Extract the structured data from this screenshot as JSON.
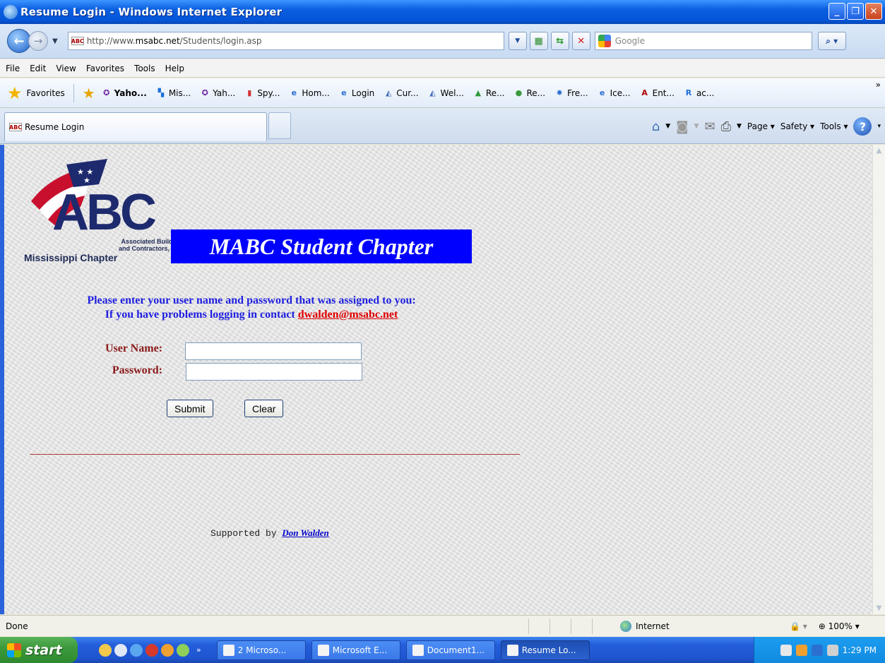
{
  "window": {
    "title": "Resume Login - Windows Internet Explorer"
  },
  "address": {
    "url_prefix": "http://www.",
    "url_domain": "msabc.net",
    "url_path": "/Students/login.asp",
    "search_placeholder": "Google"
  },
  "menu": [
    "File",
    "Edit",
    "View",
    "Favorites",
    "Tools",
    "Help"
  ],
  "favorites": {
    "label": "Favorites",
    "items": [
      {
        "label": "Yaho...",
        "icon": "yahoo-icon"
      },
      {
        "label": "Mis...",
        "icon": "msn-icon"
      },
      {
        "label": "Yah...",
        "icon": "yahoo-icon"
      },
      {
        "label": "Spy...",
        "icon": "spy-icon"
      },
      {
        "label": "Hom...",
        "icon": "ie-page-icon"
      },
      {
        "label": "Login",
        "icon": "ie-page-icon"
      },
      {
        "label": "Cur...",
        "icon": "hat-icon"
      },
      {
        "label": "Wel...",
        "icon": "hat-icon"
      },
      {
        "label": "Re...",
        "icon": "triangle-icon"
      },
      {
        "label": "Re...",
        "icon": "green-circle-icon"
      },
      {
        "label": "Fre...",
        "icon": "star-burst-icon"
      },
      {
        "label": "Ice...",
        "icon": "ie-page-icon"
      },
      {
        "label": "Ent...",
        "icon": "abc-icon"
      },
      {
        "label": "ac...",
        "icon": "rac-icon"
      }
    ]
  },
  "tab": {
    "title": "Resume Login"
  },
  "commandbar": {
    "page": "Page",
    "safety": "Safety",
    "tools": "Tools"
  },
  "page": {
    "logo_abc": "ABC",
    "logo_sub1": "Associated Builders",
    "logo_sub2": "and Contractors, Inc.",
    "logo_chapter": "Mississippi Chapter",
    "banner": "MABC Student Chapter",
    "instruction_line1": "Please enter your user name and password that was assigned to you:",
    "instruction_line2_prefix": "If you have problems logging in contact ",
    "contact_email": "dwalden@msabc.net",
    "username_label": "User Name:",
    "password_label": "Password:",
    "submit_label": "Submit",
    "clear_label": "Clear",
    "support_prefix": "Supported by ",
    "support_name": "Don Walden"
  },
  "status": {
    "text": "Done",
    "zone": "Internet",
    "zoom": "100%"
  },
  "taskbar": {
    "start": "start",
    "tasks": [
      {
        "label": "2 Microso...",
        "active": false
      },
      {
        "label": "Microsoft E...",
        "active": false
      },
      {
        "label": "Document1...",
        "active": false
      },
      {
        "label": "Resume Lo...",
        "active": true
      }
    ],
    "clock": "1:29 PM"
  },
  "colors": {
    "banner_bg": "#0000ff",
    "instruction": "#2020e0",
    "label": "#8b1a1a",
    "link_red": "#e00000",
    "rule": "#b03a3a"
  }
}
